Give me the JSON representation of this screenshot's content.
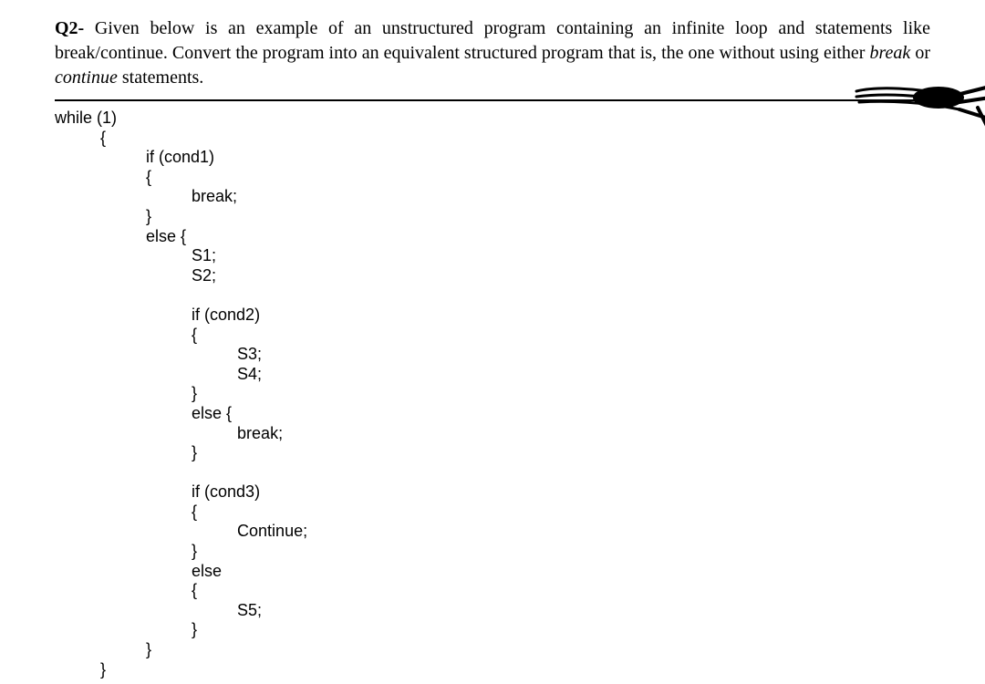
{
  "question": {
    "label": "Q2-",
    "text_part1": " Given below is an example of an unstructured program containing an infinite loop and statements like break/continue.  Convert the program into an equivalent structured program that is, the one without using either ",
    "italic1": "break",
    "mid": " or ",
    "italic2": "continue",
    "text_part2": " statements."
  },
  "code": {
    "line1": "while (1)",
    "line2": "          {",
    "line3": "                    if (cond1)",
    "line4": "                    {",
    "line5": "                              break;",
    "line6": "                    }",
    "line7": "                    else {",
    "line8": "                              S1;",
    "line9": "                              S2;",
    "line10": "",
    "line11": "                              if (cond2)",
    "line12": "                              {",
    "line13": "                                        S3;",
    "line14": "                                        S4;",
    "line15": "                              }",
    "line16": "                              else {",
    "line17": "                                        break;",
    "line18": "                              }",
    "line19": "",
    "line20": "                              if (cond3)",
    "line21": "                              {",
    "line22": "                                        Continue;",
    "line23": "                              }",
    "line24": "                              else",
    "line25": "                              {",
    "line26": "                                        S5;",
    "line27": "                              }",
    "line28": "                    }",
    "line29": "          }"
  }
}
